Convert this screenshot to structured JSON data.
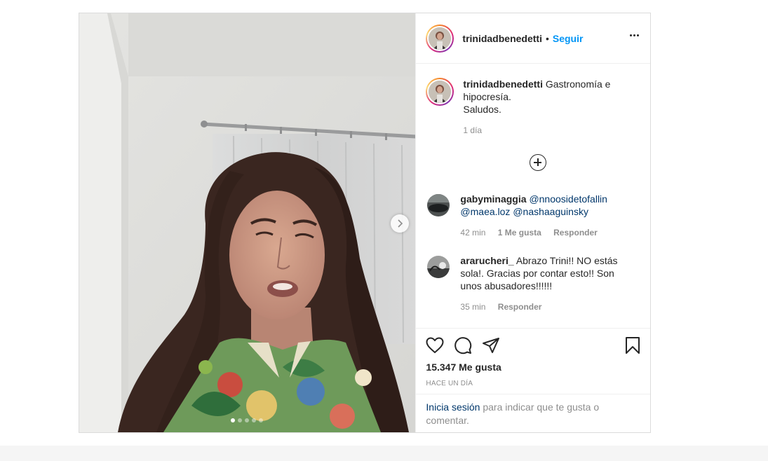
{
  "post": {
    "author": {
      "username": "trinidadbenedetti",
      "follow_label": "Seguir",
      "separator": "•"
    },
    "caption": {
      "username": "trinidadbenedetti",
      "line1": "Gastronomía e hipocresía.",
      "line2": "Saludos.",
      "time": "1 día"
    },
    "comments": [
      {
        "username": "gabyminaggia",
        "mentions": [
          "@nnoosidetofallin",
          "@maea.loz",
          "@nashaaguinsky"
        ],
        "time": "42 min",
        "likes": "1 Me gusta",
        "reply": "Responder"
      },
      {
        "username": "ararucheri_",
        "text": "Abrazo Trini!! NO estás sola!. Gracias por contar esto!! Son unos abusadores!!!!!!",
        "time": "35 min",
        "reply": "Responder"
      }
    ],
    "likes_count": "15.347 Me gusta",
    "posted_ago": "HACE UN DÍA",
    "login_prompt": {
      "link": "Inicia sesión",
      "rest": "para indicar que te gusta o comentar."
    },
    "carousel": {
      "current": 1,
      "total": 5
    }
  },
  "icons": {
    "like": "heart-icon",
    "comment": "comment-icon",
    "share": "paper-plane-icon",
    "save": "bookmark-icon",
    "more": "more-options-icon",
    "load_more": "plus-circle-icon",
    "next": "chevron-right-icon"
  },
  "colors": {
    "link_blue": "#0095f6",
    "mention": "#00376b",
    "meta_gray": "#8e8e8e",
    "text": "#262626"
  }
}
